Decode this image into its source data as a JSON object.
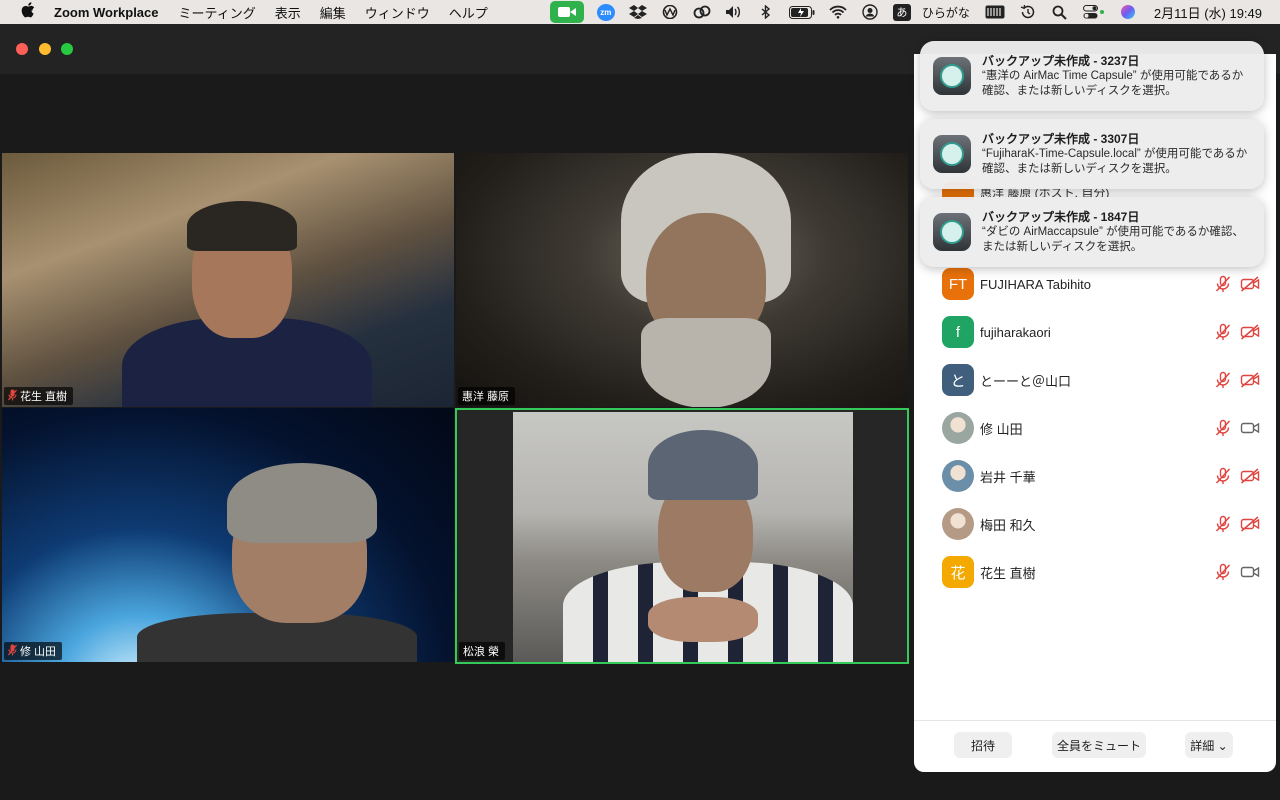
{
  "menubar": {
    "app_name": "Zoom Workplace",
    "menus": [
      "ミーティング",
      "表示",
      "編集",
      "ウィンドウ",
      "ヘルプ"
    ],
    "zm_label": "zm",
    "ime_box": "あ",
    "ime_label": "ひらがな",
    "clock": "2月11日 (水)  19:49"
  },
  "videos": [
    {
      "name": "花生 直樹",
      "muted": true
    },
    {
      "name": "惠洋 藤原",
      "muted": false
    },
    {
      "name": "修 山田",
      "muted": true
    },
    {
      "name": "松浪 榮",
      "muted": false,
      "active_speaker": true
    }
  ],
  "participants": {
    "partial_row": "惠洋 藤原 (ホスト, 自分)",
    "items": [
      {
        "initials": "FT",
        "name": "FUJIHARA Tabihito",
        "color": "#e8710a",
        "mic_muted": true,
        "video_off": true
      },
      {
        "initials": "f",
        "name": "fujiharakaori",
        "color": "#1fa463",
        "mic_muted": true,
        "video_off": true
      },
      {
        "initials": "と",
        "name": "とーーと＠山口",
        "color": "#3f5f7d",
        "mic_muted": true,
        "video_off": true
      },
      {
        "initials": "",
        "name": "修 山田",
        "color": "#9aa7a0",
        "mic_muted": true,
        "video_off": false
      },
      {
        "initials": "",
        "name": "岩井 千華",
        "color": "#6b8fa8",
        "mic_muted": true,
        "video_off": true
      },
      {
        "initials": "",
        "name": "梅田 和久",
        "color": "#b59a86",
        "mic_muted": true,
        "video_off": true
      },
      {
        "initials": "花",
        "name": "花生 直樹",
        "color": "#f4a900",
        "mic_muted": true,
        "video_off": false
      }
    ],
    "footer": {
      "invite": "招待",
      "mute_all": "全員をミュート",
      "more": "詳細 ⌄"
    }
  },
  "notifications": [
    {
      "title": "バックアップ未作成 - 3237日",
      "body": "“惠洋の AirMac Time Capsule” が使用可能であるか確認、または新しいディスクを選択。"
    },
    {
      "title": "バックアップ未作成 - 3307日",
      "body": "“FujiharaK-Time-Capsule.local” が使用可能であるか確認、または新しいディスクを選択。"
    },
    {
      "title": "バックアップ未作成 - 1847日",
      "body": "“ダビの AirMaccapsule” が使用可能であるか確認、または新しいディスクを選択。"
    }
  ],
  "colors": {
    "muted_red": "#e0443e",
    "active_speaker": "#35c95a"
  }
}
